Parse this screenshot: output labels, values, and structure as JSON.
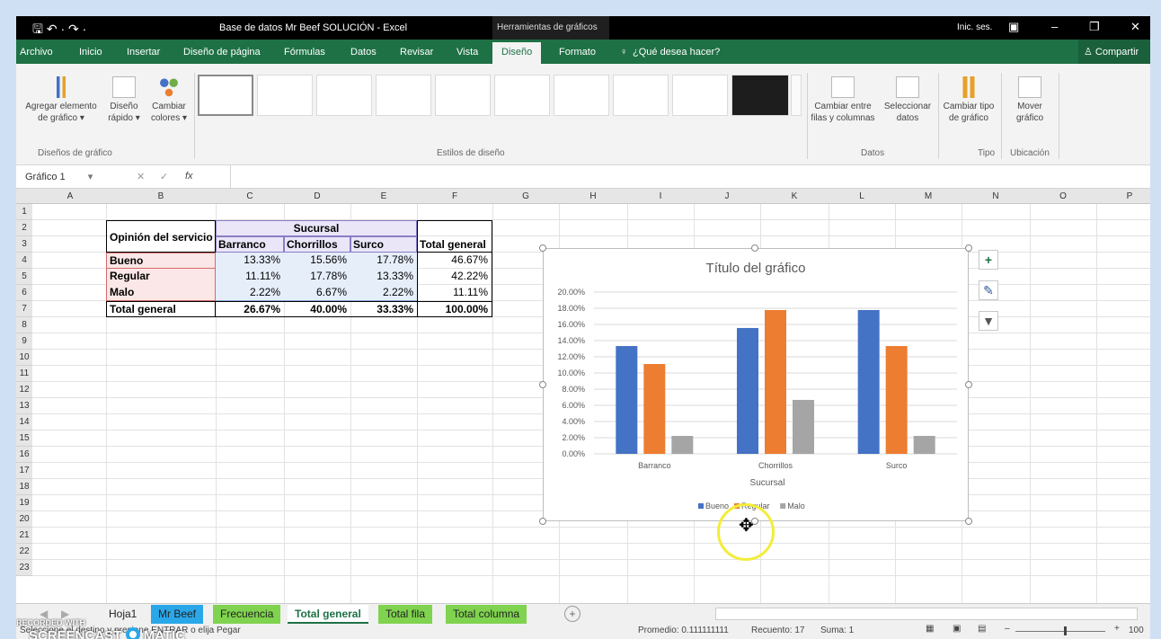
{
  "window": {
    "document_title": "Base de datos Mr Beef SOLUCIÓN  -  Excel",
    "contextual_title": "Herramientas de gráficos",
    "user": "Inic. ses.",
    "quick_access": "🖫 ↶ · ↷ ·"
  },
  "tabs": [
    {
      "label": "Archivo",
      "key": "archivo"
    },
    {
      "label": "Inicio",
      "key": "inicio"
    },
    {
      "label": "Insertar",
      "key": "insertar"
    },
    {
      "label": "Diseño de página",
      "key": "diseno-pagina"
    },
    {
      "label": "Fórmulas",
      "key": "formulas"
    },
    {
      "label": "Datos",
      "key": "datos"
    },
    {
      "label": "Revisar",
      "key": "revisar"
    },
    {
      "label": "Vista",
      "key": "vista"
    },
    {
      "label": "Diseño",
      "key": "diseno"
    },
    {
      "label": "Formato",
      "key": "formato"
    }
  ],
  "tell_me": "¿Qué desea hacer?",
  "share": "Compartir",
  "ribbon": {
    "add_element": "Agregar elemento de gráfico ▾",
    "quick_layout": "Diseño rápido ▾",
    "change_colors": "Cambiar colores ▾",
    "group_layouts": "Diseños de gráfico",
    "group_styles": "Estilos de diseño",
    "switch_rowcol": "Cambiar entre filas y columnas",
    "select_data": "Seleccionar datos",
    "group_data": "Datos",
    "change_type": "Cambiar tipo de gráfico",
    "group_type": "Tipo",
    "move_chart": "Mover gráfico",
    "group_location": "Ubicación"
  },
  "formula_bar": {
    "name_box": "Gráfico 1",
    "fx": "fx",
    "content": ""
  },
  "columns": [
    "A",
    "B",
    "C",
    "D",
    "E",
    "F",
    "G",
    "H",
    "I",
    "J",
    "K",
    "L",
    "M",
    "N",
    "O",
    "P"
  ],
  "rows": [
    "1",
    "2",
    "3",
    "4",
    "5",
    "6",
    "7",
    "8",
    "9",
    "10",
    "11",
    "12",
    "13",
    "14",
    "15",
    "16",
    "17",
    "18",
    "19",
    "20",
    "21",
    "22",
    "23"
  ],
  "table": {
    "corner_label": "Opinión del servicio",
    "group_header": "Sucursal",
    "col_headers": [
      "Barranco",
      "Chorrillos",
      "Surco",
      "Total general"
    ],
    "rows": [
      {
        "label": "Bueno",
        "values": [
          "13.33%",
          "15.56%",
          "17.78%",
          "46.67%"
        ]
      },
      {
        "label": "Regular",
        "values": [
          "11.11%",
          "17.78%",
          "13.33%",
          "42.22%"
        ]
      },
      {
        "label": "Malo",
        "values": [
          "2.22%",
          "6.67%",
          "2.22%",
          "11.11%"
        ]
      }
    ],
    "total": {
      "label": "Total general",
      "values": [
        "26.67%",
        "40.00%",
        "33.33%",
        "100.00%"
      ]
    }
  },
  "chart_data": {
    "type": "bar",
    "title": "Título del gráfico",
    "xlabel": "Sucursal",
    "categories": [
      "Barranco",
      "Chorrillos",
      "Surco"
    ],
    "series": [
      {
        "name": "Bueno",
        "values": [
          13.33,
          15.56,
          17.78
        ],
        "color": "#4472c4"
      },
      {
        "name": "Regular",
        "values": [
          11.11,
          17.78,
          13.33
        ],
        "color": "#ed7d31"
      },
      {
        "name": "Malo",
        "values": [
          2.22,
          6.67,
          2.22
        ],
        "color": "#a5a5a5"
      }
    ],
    "ylim": [
      0,
      20
    ],
    "yticks": [
      "0.00%",
      "2.00%",
      "4.00%",
      "6.00%",
      "8.00%",
      "10.00%",
      "12.00%",
      "14.00%",
      "16.00%",
      "18.00%",
      "20.00%"
    ],
    "grid": true,
    "legend": "bottom"
  },
  "sheet_tabs": [
    {
      "label": "Hoja1",
      "color": "#f0f0f0"
    },
    {
      "label": "Mr Beef",
      "color": "#2aa7e8"
    },
    {
      "label": "Frecuencia",
      "color": "#7fd34e"
    },
    {
      "label": "Total general",
      "color": "#ffffff"
    },
    {
      "label": "Total fila",
      "color": "#7fd34e"
    },
    {
      "label": "Total columna",
      "color": "#7fd34e"
    }
  ],
  "status": {
    "message": "Seleccione el destino y presione ENTRAR o elija Pegar",
    "average": "Promedio: 0.111111111",
    "count": "Recuento: 17",
    "sum": "Suma: 1",
    "zoom": "100"
  },
  "watermark": {
    "line1": "RECORDED WITH",
    "line2": "SCREENCAST",
    "line3": "MATIC"
  }
}
